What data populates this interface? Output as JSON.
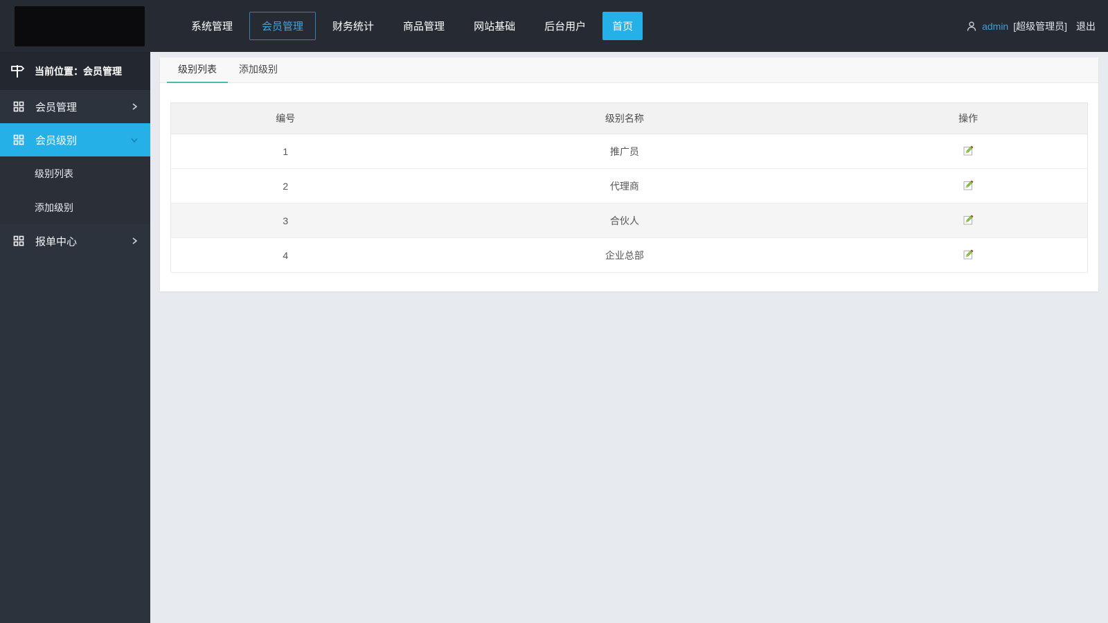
{
  "topbar": {
    "nav_items": [
      {
        "label": "系统管理"
      },
      {
        "label": "会员管理"
      },
      {
        "label": "财务统计"
      },
      {
        "label": "商品管理"
      },
      {
        "label": "网站基础"
      },
      {
        "label": "后台用户"
      },
      {
        "label": "首页"
      }
    ],
    "user": {
      "name": "admin",
      "role": "[超级管理员]",
      "logout_label": "退出"
    }
  },
  "sidebar": {
    "location": "当前位置：会员管理",
    "items": [
      {
        "label": "会员管理"
      },
      {
        "label": "会员级别"
      },
      {
        "label": "报单中心"
      }
    ],
    "sub_items": [
      {
        "label": "级别列表"
      },
      {
        "label": "添加级别"
      }
    ]
  },
  "content": {
    "tabs": [
      {
        "label": "级别列表"
      },
      {
        "label": "添加级别"
      }
    ],
    "table": {
      "columns": [
        "编号",
        "级别名称",
        "操作"
      ],
      "rows": [
        {
          "id": "1",
          "name": "推广员"
        },
        {
          "id": "2",
          "name": "代理商"
        },
        {
          "id": "3",
          "name": "合伙人"
        },
        {
          "id": "4",
          "name": "企业总部"
        }
      ]
    }
  },
  "colors": {
    "accent_blue": "#26b0e8",
    "tab_underline": "#4ab8b8",
    "topbar_bg": "#262b33",
    "sidebar_bg": "#2d333d",
    "sidebar_submenu_bg": "#2a2f38",
    "page_bg": "#e7eaee",
    "table_header_bg": "#f2f2f2",
    "stripe_row_bg": "#f5f5f5"
  },
  "icons": {
    "user": "person-icon",
    "location": "signpost-icon",
    "menu": "grid-icon",
    "edit": "edit-pencil-icon"
  }
}
